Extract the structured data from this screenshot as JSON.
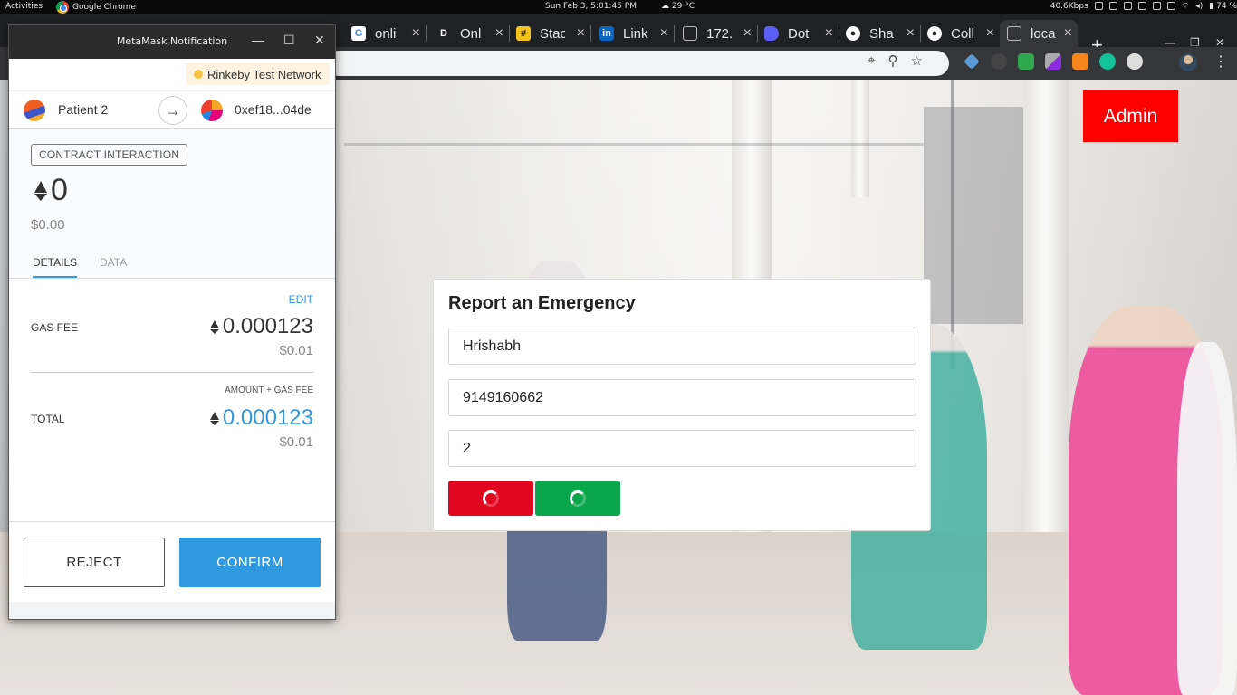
{
  "system_bar": {
    "activities": "Activities",
    "app_name": "Google Chrome",
    "clock": "Sun Feb 3,  5:01:45 PM",
    "weather": "29 °C",
    "net_speed": "40.6Kbps",
    "battery": "74 %"
  },
  "browser": {
    "tabs": [
      {
        "title": "onli",
        "icon": "google-icon",
        "color": "#ffffff"
      },
      {
        "title": "Onl",
        "icon": "d-icon",
        "color": "#202124"
      },
      {
        "title": "Stac",
        "icon": "slack-icon",
        "color": "#f4c21b"
      },
      {
        "title": "Link",
        "icon": "linkedin-icon",
        "color": "#0a66c2"
      },
      {
        "title": "172.",
        "icon": "page-icon",
        "color": "#5f6368"
      },
      {
        "title": "Dot",
        "icon": "dot-icon",
        "color": "#5b5ff6"
      },
      {
        "title": "Sha",
        "icon": "github-icon",
        "color": "#202124"
      },
      {
        "title": "Coll",
        "icon": "github-icon",
        "color": "#202124"
      },
      {
        "title": "loca",
        "icon": "page-icon",
        "color": "#5f6368"
      }
    ],
    "new_tab": "+"
  },
  "page": {
    "admin_label": "Admin",
    "form": {
      "title": "Report an Emergency",
      "name_value": "Hrishabh",
      "phone_value": "9149160662",
      "count_value": "2"
    },
    "colors": {
      "admin": "#ff0000",
      "red_button": "#e0061f",
      "green_button": "#0aa64b"
    }
  },
  "metamask": {
    "window_title": "MetaMask Notification",
    "network": "Rinkeby Test Network",
    "from_account": "Patient 2",
    "to_account": "0xef18...04de",
    "badge": "CONTRACT INTERACTION",
    "amount_eth": "0",
    "amount_usd": "$0.00",
    "tabs": [
      "DETAILS",
      "DATA"
    ],
    "edit": "EDIT",
    "gas_fee_label": "GAS FEE",
    "gas_fee_eth": "0.000123",
    "gas_fee_usd": "$0.01",
    "amount_plus_gas": "AMOUNT + GAS FEE",
    "total_label": "TOTAL",
    "total_eth": "0.000123",
    "total_usd": "$0.01",
    "reject": "REJECT",
    "confirm": "CONFIRM",
    "accent": "#2f9ae0"
  }
}
